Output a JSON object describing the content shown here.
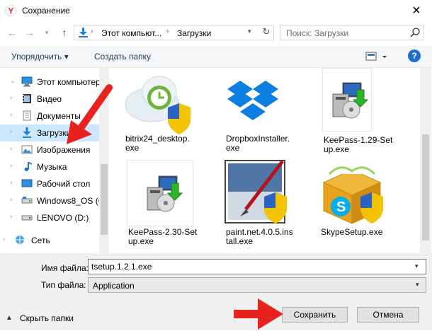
{
  "window": {
    "title": "Сохранение",
    "close": "✕"
  },
  "nav": {
    "address_segments": [
      "Этот компьют...",
      "Загрузки"
    ],
    "search_placeholder": "Поиск: Загрузки"
  },
  "toolbar": {
    "organize_label": "Упорядочить ▾",
    "new_folder_label": "Создать папку",
    "help_label": "?"
  },
  "tree": [
    {
      "label": "Этот компьютер",
      "icon": "computer-icon",
      "expanded": true
    },
    {
      "label": "Видео",
      "icon": "video-folder-icon"
    },
    {
      "label": "Документы",
      "icon": "documents-folder-icon"
    },
    {
      "label": "Загрузки",
      "icon": "downloads-folder-icon",
      "selected": true
    },
    {
      "label": "Изображения",
      "icon": "pictures-folder-icon"
    },
    {
      "label": "Музыка",
      "icon": "music-folder-icon"
    },
    {
      "label": "Рабочий стол",
      "icon": "desktop-folder-icon"
    },
    {
      "label": "Windows8_OS (C",
      "icon": "drive-icon"
    },
    {
      "label": "LENOVO (D:)",
      "icon": "drive-icon"
    },
    {
      "label": "Сеть",
      "icon": "network-icon"
    }
  ],
  "files": [
    {
      "name": "bitrix24_desktop.exe",
      "lines": [
        "bitrix24_desktop.",
        "exe"
      ],
      "icon": "bitrix24-icon"
    },
    {
      "name": "DropboxInstaller.exe",
      "lines": [
        "DropboxInstaller.",
        "exe"
      ],
      "icon": "dropbox-icon"
    },
    {
      "name": "KeePass-1.29-Setup.exe",
      "lines": [
        "KeePass-1.29-Set",
        "up.exe"
      ],
      "icon": "installer-icon"
    },
    {
      "name": "KeePass-2.30-Setup.exe",
      "lines": [
        "KeePass-2.30-Set",
        "up.exe"
      ],
      "icon": "installer-icon"
    },
    {
      "name": "paint.net.4.0.5.install.exe",
      "lines": [
        "paint.net.4.0.5.ins",
        "tall.exe"
      ],
      "icon": "paintnet-icon"
    },
    {
      "name": "SkypeSetup.exe",
      "lines": [
        "SkypeSetup.exe"
      ],
      "icon": "skype-icon"
    }
  ],
  "form": {
    "file_name_label": "Имя файла:",
    "file_name_value": "tsetup.1.2.1.exe",
    "file_type_label": "Тип файла:",
    "file_type_value": "Application",
    "hide_folders_label": "Скрыть папки",
    "save_label": "Сохранить",
    "cancel_label": "Отмена"
  },
  "colors": {
    "accent": "#1f6fd1",
    "selection": "#cce8ff",
    "annotation_arrow": "#e8231f"
  }
}
